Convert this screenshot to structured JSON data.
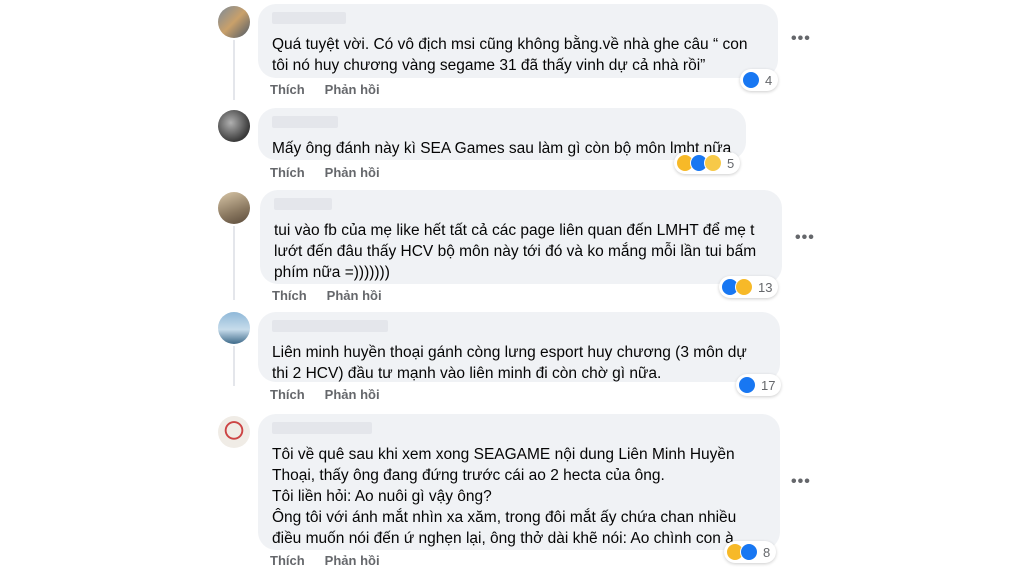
{
  "actions": {
    "like": "Thích",
    "reply": "Phản hồi"
  },
  "more_label": "•••",
  "colors": {
    "like": "#1877f2",
    "haha": "#f7b928",
    "sad": "#f7b928",
    "bubble": "#f0f2f5",
    "action": "#65676b"
  },
  "comments": [
    {
      "text": "Quá tuyệt vời. Có vô địch msi cũng không bằng.về nhà ghe câu “ con\ntôi nó huy chương vàng segame 31 đã thấy vinh dự cả nhà rồi”",
      "reactions": [
        "like-icon"
      ],
      "count": "4"
    },
    {
      "text": "Mấy ông đánh này kì SEA Games sau làm gì còn bộ môn lmht nữa",
      "reactions": [
        "haha-icon",
        "like-icon",
        "sad-icon"
      ],
      "count": "5"
    },
    {
      "text": "tui vào fb của mẹ like hết tất cả các page liên quan đến LMHT để mẹ t\nlướt đến đâu thấy HCV bộ môn này tới đó và ko mắng mỗi lần tui bấm\nphím nữa =)))))))",
      "reactions": [
        "like-icon",
        "haha-icon"
      ],
      "count": "13"
    },
    {
      "text": "Liên minh huyền thoại gánh còng lưng esport huy chương (3 môn dự\nthi 2 HCV) đầu tư mạnh vào liên minh đi còn chờ gì nữa.",
      "reactions": [
        "like-icon"
      ],
      "count": "17"
    },
    {
      "text": "Tôi về quê sau khi xem xong SEAGAME nội dung Liên Minh Huyền\nThoại, thấy ông đang đứng trước cái ao 2 hecta của ông.\nTôi liền hỏi: Ao nuôi gì vậy ông?\nÔng tôi với ánh mắt nhìn xa xăm, trong đôi mắt ấy chứa chan nhiều\nđiều muốn nói đến ứ nghẹn lại, ông thở dài khẽ nói: Ao chình con à.",
      "reactions": [
        "haha-icon",
        "like-icon"
      ],
      "count": "8"
    }
  ]
}
